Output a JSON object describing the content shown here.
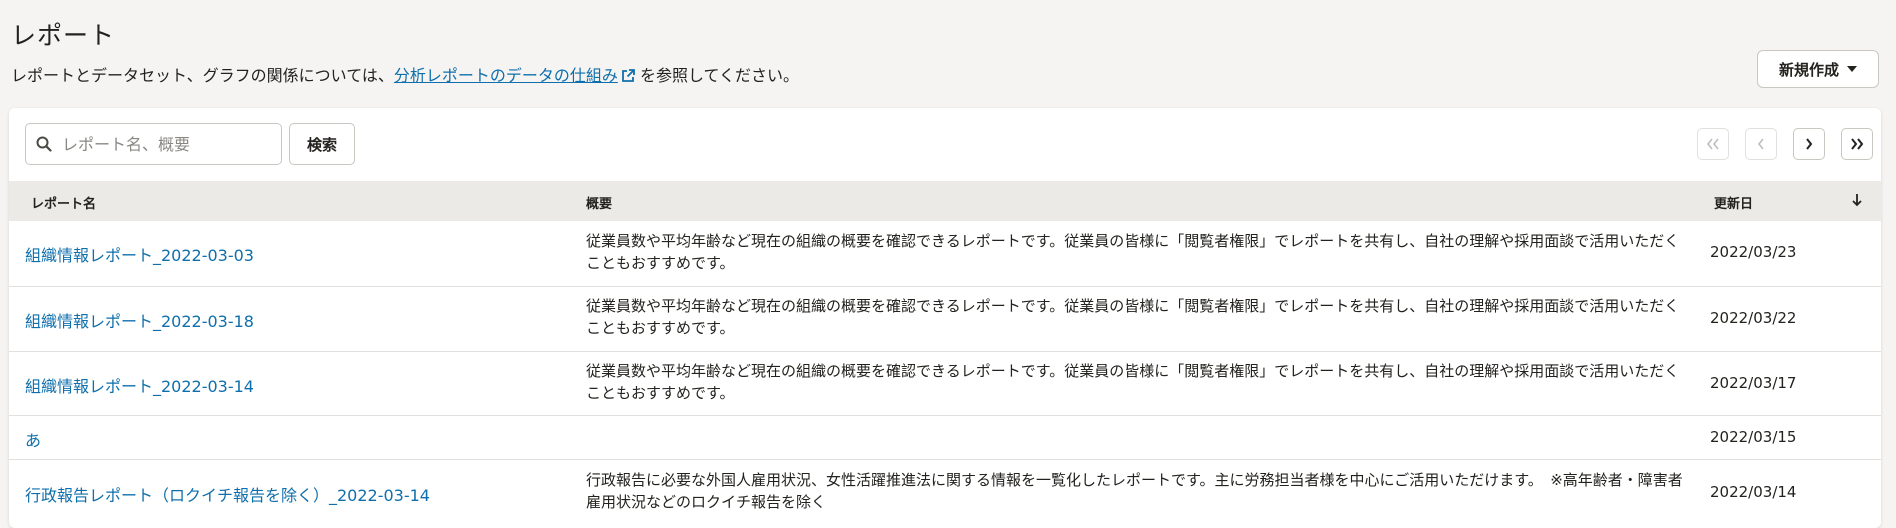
{
  "page": {
    "title": "レポート",
    "intro_before": "レポートとデータセット、グラフの関係については、",
    "intro_link": "分析レポートのデータの仕組み",
    "intro_after": " を参照してください。",
    "new_button": "新規作成"
  },
  "search": {
    "placeholder": "レポート名、概要",
    "button": "検索"
  },
  "pager": {
    "first": "first-page-icon",
    "prev": "prev-page-icon",
    "next": "next-page-icon",
    "last": "last-page-icon"
  },
  "table": {
    "headers": {
      "name": "レポート名",
      "summary": "概要",
      "updated": "更新日"
    },
    "rows": [
      {
        "name": "組織情報レポート_2022-03-03",
        "summary": "従業員数や平均年齢など現在の組織の概要を確認できるレポートです。従業員の皆様に「閲覧者権限」でレポートを共有し、自社の理解や採用面談で活用いただくこともおすすめです。",
        "updated": "2022/03/23"
      },
      {
        "name": "組織情報レポート_2022-03-18",
        "summary": "従業員数や平均年齢など現在の組織の概要を確認できるレポートです。従業員の皆様に「閲覧者権限」でレポートを共有し、自社の理解や採用面談で活用いただくこともおすすめです。",
        "updated": "2022/03/22"
      },
      {
        "name": "組織情報レポート_2022-03-14",
        "summary": "従業員数や平均年齢など現在の組織の概要を確認できるレポートです。従業員の皆様に「閲覧者権限」でレポートを共有し、自社の理解や採用面談で活用いただくこともおすすめです。",
        "updated": "2022/03/17"
      },
      {
        "name": "あ",
        "summary": "",
        "updated": "2022/03/15"
      },
      {
        "name": "行政報告レポート（ロクイチ報告を除く）_2022-03-14",
        "summary": "行政報告に必要な外国人雇用状況、女性活躍推進法に関する情報を一覧化したレポートです。主に労務担当者様を中心にご活用いただけます。　※高年齢者・障害者雇用状況などのロクイチ報告を除く",
        "updated": "2022/03/14"
      }
    ]
  },
  "colors": {
    "background": "#f5f4f2",
    "link": "#0f6fac",
    "header_bg": "#ebeae6",
    "text": "#23221e"
  }
}
